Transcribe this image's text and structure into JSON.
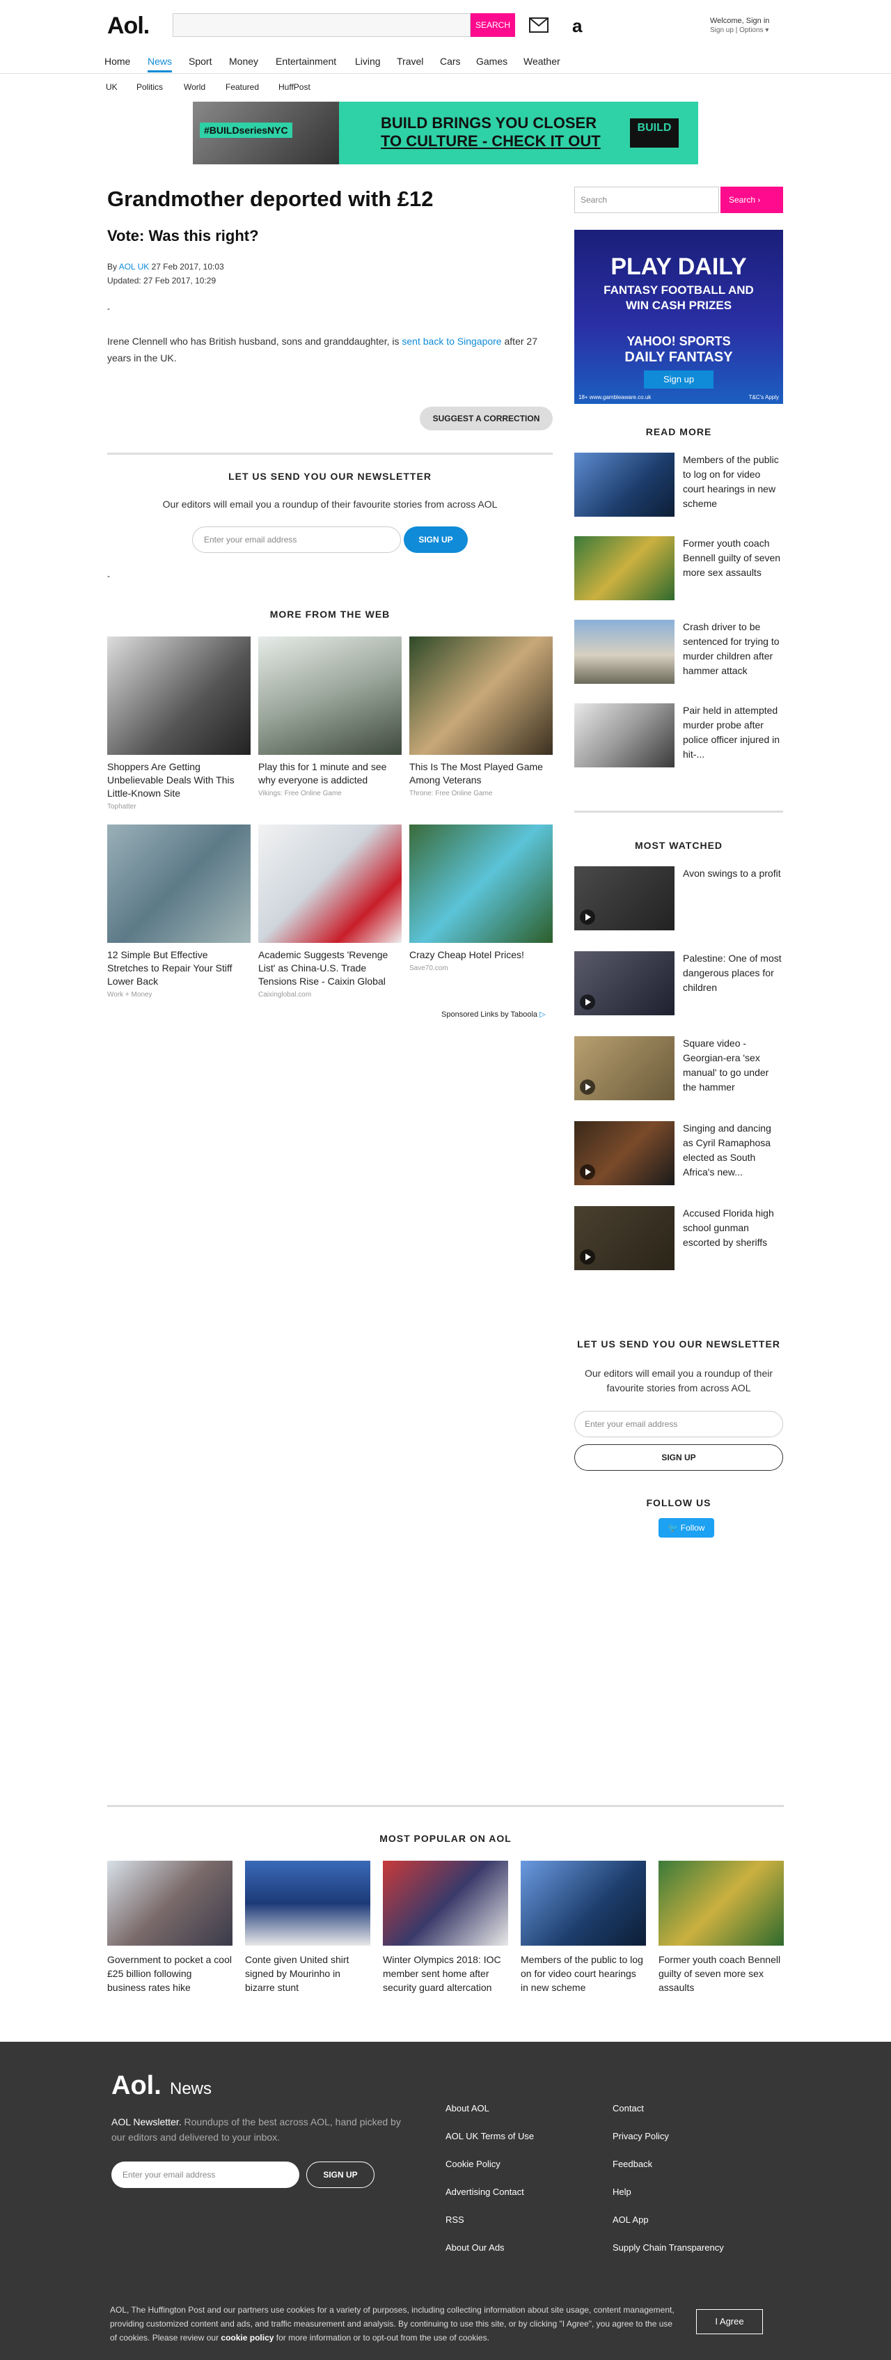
{
  "header": {
    "logo": "Aol.",
    "search_button": "SEARCH",
    "welcome": "Welcome, Sign in",
    "sign_up": "Sign up",
    "options": "Options"
  },
  "nav": {
    "items": [
      "Home",
      "News",
      "Sport",
      "Money",
      "Entertainment",
      "Living",
      "Travel",
      "Cars",
      "Games",
      "Weather"
    ],
    "active": "News",
    "sub_items": [
      "UK",
      "Politics",
      "World",
      "Featured",
      "HuffPost"
    ]
  },
  "ad_banner": {
    "tag": "#BUILDseriesNYC",
    "text_line1": "BUILD BRINGS YOU CLOSER",
    "text_line2": "TO CULTURE - CHECK IT OUT",
    "logo": "BUILD"
  },
  "article": {
    "headline": "Grandmother deported with £12",
    "subhead": "Vote: Was this right?",
    "by_label": "By",
    "author": "AOL UK",
    "published": "27 Feb 2017, 10:03",
    "updated": "Updated: 27 Feb 2017, 10:29",
    "dash": "-",
    "body_before": "Irene Clennell who has British husband, sons and granddaughter, is ",
    "body_link": "sent back to Singapore",
    "body_after": " after 27 years in the UK.",
    "correction_button": "SUGGEST A CORRECTION"
  },
  "newsletter": {
    "title": "LET US SEND YOU OUR NEWSLETTER",
    "subtitle": "Our editors will email you a roundup of their favourite stories from across AOL",
    "email_placeholder": "Enter your email address",
    "signup": "SIGN UP"
  },
  "more_from_web": {
    "title": "MORE FROM THE WEB",
    "items": [
      {
        "title": "Shoppers Are Getting Unbelievable Deals With This Little-Known Site",
        "source": "Tophatter"
      },
      {
        "title": "Play this for 1 minute and see why everyone is addicted",
        "source": "Vikings: Free Online Game"
      },
      {
        "title": "This Is The Most Played Game Among Veterans",
        "source": "Throne: Free Online Game"
      },
      {
        "title": "12 Simple But Effective Stretches to Repair Your Stiff Lower Back",
        "source": "Work + Money"
      },
      {
        "title": "Academic Suggests 'Revenge List' as China-U.S. Trade Tensions Rise - Caixin Global",
        "source": "Caixinglobal.com"
      },
      {
        "title": "Crazy Cheap Hotel Prices!",
        "source": "Save70.com"
      }
    ],
    "sponsored": "Sponsored Links by Taboola"
  },
  "sidebar": {
    "search_placeholder": "Search",
    "search_button": "Search",
    "ad": {
      "line1": "PLAY DAILY",
      "line2a": "FANTASY FOOTBALL AND",
      "line2b": "WIN CASH PRIZES",
      "line3": "YAHOO! SPORTS",
      "line4": "DAILY FANTASY",
      "button": "Sign up",
      "small_left": "18+ www.gambleaware.co.uk",
      "small_right": "T&C's Apply"
    },
    "read_more_title": "READ MORE",
    "read_more": [
      "Members of the public to log on for video court hearings in new scheme",
      "Former youth coach Bennell guilty of seven more sex assaults",
      "Crash driver to be sentenced for trying to murder children after hammer attack",
      "Pair held in attempted murder probe after police officer injured in hit-..."
    ],
    "most_watched_title": "MOST WATCHED",
    "most_watched": [
      "Avon swings to a profit",
      "Palestine: One of most dangerous places for children",
      "Square video - Georgian-era 'sex manual' to go under the hammer",
      "Singing and dancing as Cyril Ramaphosa elected as South Africa's new...",
      "Accused Florida high school gunman escorted by sheriffs"
    ],
    "newsletter_title": "LET US SEND YOU OUR NEWSLETTER",
    "newsletter_sub": "Our editors will email you a roundup of their favourite stories from across AOL",
    "newsletter_placeholder": "Enter your email address",
    "newsletter_button": "SIGN UP",
    "follow_title": "FOLLOW US",
    "follow_button": "Follow"
  },
  "most_popular": {
    "title": "MOST POPULAR ON AOL",
    "items": [
      "Government to pocket a cool £25 billion following business rates hike",
      "Conte given United shirt signed by Mourinho in bizarre stunt",
      "Winter Olympics 2018: IOC member sent home after security guard altercation",
      "Members of the public to log on for video court hearings in new scheme",
      "Former youth coach Bennell guilty of seven more sex assaults"
    ]
  },
  "footer": {
    "logo": "Aol.",
    "logo_suffix": "News",
    "newsletter_bold": "AOL Newsletter.",
    "newsletter_desc": " Roundups of the best across AOL, hand picked by our editors and delivered to your inbox.",
    "email_placeholder": "Enter your email address",
    "signup": "SIGN UP",
    "links_col1": [
      "About AOL",
      "AOL UK Terms of Use",
      "Cookie Policy",
      "Advertising Contact",
      "RSS",
      "About Our Ads"
    ],
    "links_col2": [
      "Contact",
      "Privacy Policy",
      "Feedback",
      "Help",
      "AOL App",
      "Supply Chain Transparency"
    ],
    "cookie_text_1": "AOL, The Huffington Post and our partners use cookies for a variety of purposes, including collecting information about site usage, content management, providing customized content and ads, and traffic measurement and analysis. By continuing to use this site, or by clicking \"I Agree\", you agree to the use of cookies. Please review our ",
    "cookie_link": "cookie policy",
    "cookie_text_2": " for more information or to opt-out from the use of cookies.",
    "agree_button": "I Agree"
  },
  "colors": {
    "accent_pink": "#ff0b8d",
    "link_blue": "#0f8bd7",
    "footer_bg": "#373737"
  }
}
